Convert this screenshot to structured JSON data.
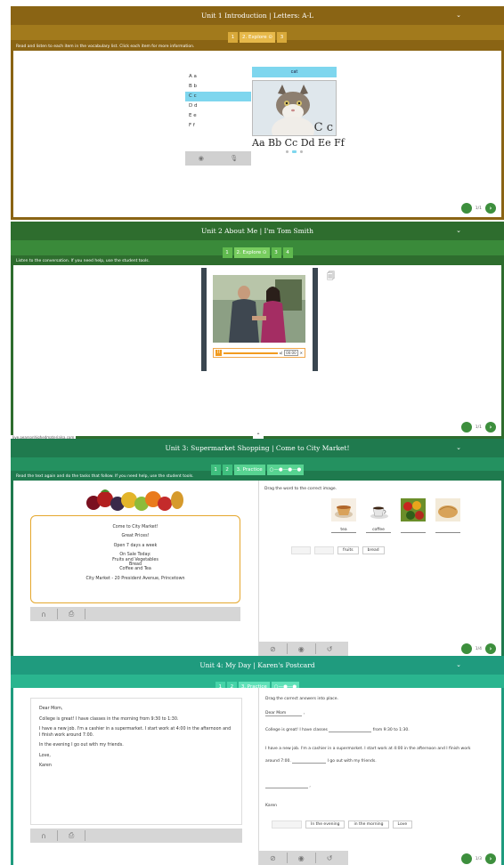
{
  "unit1": {
    "title": "Unit 1 Introduction  |  Letters: A-L",
    "steps": [
      "1",
      "2. Explore ⊙",
      "3"
    ],
    "instruction": "Read and listen to each item in the vocabulary list. Click each item for more information.",
    "letters": [
      "A a",
      "B b",
      "C c",
      "D d",
      "E e",
      "F f"
    ],
    "selected_letter": "C c",
    "card_word": "cat",
    "card_caption": "C c",
    "alphabet_line": "Aa Bb Cc Dd Ee Ff",
    "page": "1/1"
  },
  "unit2": {
    "title": "Unit 2 About Me  |  I'm Tom Smith",
    "steps": [
      "1",
      "2. Explore ⊙",
      "3",
      "4"
    ],
    "instruction": "Listen to the conversation. If you need help, use the student tools.",
    "time": "00:00",
    "page": "1/1",
    "footer_url": "live.pearsonhighedmaterialsa.com"
  },
  "unit3": {
    "title": "Unit 3: Supermarket Shopping  |  Come to City Market!",
    "steps": [
      "1",
      "2",
      "3. Practice"
    ],
    "instruction": "Read the text again and do the tasks that follow. If you need help, use the student tools.",
    "market_lines": [
      "Come to City Market!",
      "",
      "Great Prices!",
      "",
      "Open 7 days a week",
      "",
      "On Sale Today:",
      "Fruits and Vegetables",
      "Bread",
      "Coffee and Tea",
      "",
      "City Market - 20 President Avenue, Princetown"
    ],
    "drag_instruction": "Drag the word to the correct image.",
    "image_labels": [
      "tea",
      "coffee",
      "",
      ""
    ],
    "chips": [
      "fruits",
      "bread"
    ],
    "page": "1/4"
  },
  "unit4": {
    "title": "Unit 4: My Day  |  Karen's Postcard",
    "steps": [
      "1",
      "2",
      "3. Practice"
    ],
    "postcard": [
      "Dear Mom,",
      "College is great! I have classes in the morning from 9:30 to 1:30.",
      "I have a new job. I'm a cashier in a supermarket. I start work at 4:00 in the afternoon and I finish work around 7:00.",
      "In the evening I go out with my friends.",
      "Love,",
      "Karen"
    ],
    "drag_instruction": "Drag the correct answers into place.",
    "r_dear": "Dear Mom",
    "r_line1a": "College is great! I have classes",
    "r_line1b": "from 9:30 to 1:30.",
    "r_line2": "I have a new job. I'm a cashier in a supermarket. I start work at 4:00 in the afternoon and I finish work",
    "r_line3a": "around 7:00.",
    "r_line3b": "I go out with my friends.",
    "r_karen": "Karen",
    "chips": [
      "In the evening",
      "in the morning",
      "Love"
    ],
    "page": "1/3"
  }
}
